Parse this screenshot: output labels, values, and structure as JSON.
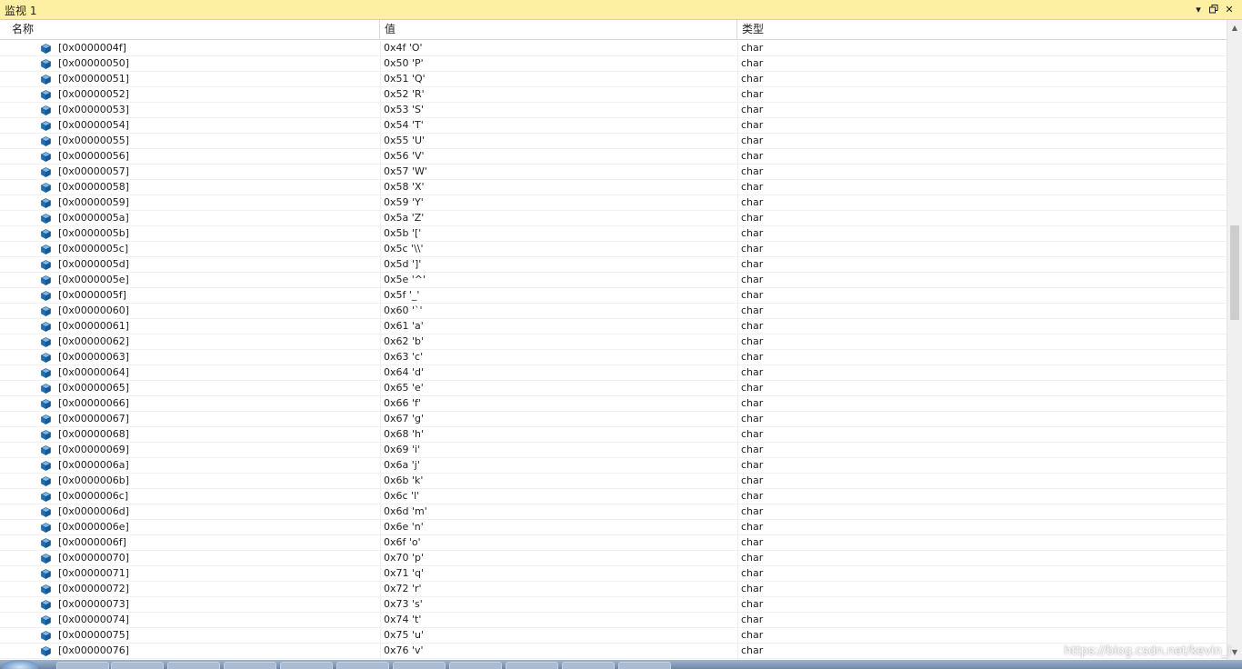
{
  "window": {
    "title": "监视 1"
  },
  "title_buttons": {
    "dropdown": "▾",
    "restore": "🗗",
    "close": "✕"
  },
  "columns": {
    "name": "名称",
    "value": "值",
    "type": "类型"
  },
  "rows": [
    {
      "name": "[0x0000004f]",
      "value": "0x4f 'O'",
      "type": "char"
    },
    {
      "name": "[0x00000050]",
      "value": "0x50 'P'",
      "type": "char"
    },
    {
      "name": "[0x00000051]",
      "value": "0x51 'Q'",
      "type": "char"
    },
    {
      "name": "[0x00000052]",
      "value": "0x52 'R'",
      "type": "char"
    },
    {
      "name": "[0x00000053]",
      "value": "0x53 'S'",
      "type": "char"
    },
    {
      "name": "[0x00000054]",
      "value": "0x54 'T'",
      "type": "char"
    },
    {
      "name": "[0x00000055]",
      "value": "0x55 'U'",
      "type": "char"
    },
    {
      "name": "[0x00000056]",
      "value": "0x56 'V'",
      "type": "char"
    },
    {
      "name": "[0x00000057]",
      "value": "0x57 'W'",
      "type": "char"
    },
    {
      "name": "[0x00000058]",
      "value": "0x58 'X'",
      "type": "char"
    },
    {
      "name": "[0x00000059]",
      "value": "0x59 'Y'",
      "type": "char"
    },
    {
      "name": "[0x0000005a]",
      "value": "0x5a 'Z'",
      "type": "char"
    },
    {
      "name": "[0x0000005b]",
      "value": "0x5b '['",
      "type": "char"
    },
    {
      "name": "[0x0000005c]",
      "value": "0x5c '\\\\'",
      "type": "char"
    },
    {
      "name": "[0x0000005d]",
      "value": "0x5d ']'",
      "type": "char"
    },
    {
      "name": "[0x0000005e]",
      "value": "0x5e '^'",
      "type": "char"
    },
    {
      "name": "[0x0000005f]",
      "value": "0x5f '_'",
      "type": "char"
    },
    {
      "name": "[0x00000060]",
      "value": "0x60 '`'",
      "type": "char"
    },
    {
      "name": "[0x00000061]",
      "value": "0x61 'a'",
      "type": "char"
    },
    {
      "name": "[0x00000062]",
      "value": "0x62 'b'",
      "type": "char"
    },
    {
      "name": "[0x00000063]",
      "value": "0x63 'c'",
      "type": "char"
    },
    {
      "name": "[0x00000064]",
      "value": "0x64 'd'",
      "type": "char"
    },
    {
      "name": "[0x00000065]",
      "value": "0x65 'e'",
      "type": "char"
    },
    {
      "name": "[0x00000066]",
      "value": "0x66 'f'",
      "type": "char"
    },
    {
      "name": "[0x00000067]",
      "value": "0x67 'g'",
      "type": "char"
    },
    {
      "name": "[0x00000068]",
      "value": "0x68 'h'",
      "type": "char"
    },
    {
      "name": "[0x00000069]",
      "value": "0x69 'i'",
      "type": "char"
    },
    {
      "name": "[0x0000006a]",
      "value": "0x6a 'j'",
      "type": "char"
    },
    {
      "name": "[0x0000006b]",
      "value": "0x6b 'k'",
      "type": "char"
    },
    {
      "name": "[0x0000006c]",
      "value": "0x6c 'l'",
      "type": "char"
    },
    {
      "name": "[0x0000006d]",
      "value": "0x6d 'm'",
      "type": "char"
    },
    {
      "name": "[0x0000006e]",
      "value": "0x6e 'n'",
      "type": "char"
    },
    {
      "name": "[0x0000006f]",
      "value": "0x6f 'o'",
      "type": "char"
    },
    {
      "name": "[0x00000070]",
      "value": "0x70 'p'",
      "type": "char"
    },
    {
      "name": "[0x00000071]",
      "value": "0x71 'q'",
      "type": "char"
    },
    {
      "name": "[0x00000072]",
      "value": "0x72 'r'",
      "type": "char"
    },
    {
      "name": "[0x00000073]",
      "value": "0x73 's'",
      "type": "char"
    },
    {
      "name": "[0x00000074]",
      "value": "0x74 't'",
      "type": "char"
    },
    {
      "name": "[0x00000075]",
      "value": "0x75 'u'",
      "type": "char"
    },
    {
      "name": "[0x00000076]",
      "value": "0x76 'v'",
      "type": "char"
    }
  ],
  "watermark": "https://blog.csdn.net/kevin_i",
  "colors": {
    "title_bar": "#fdf0a2",
    "row_icon": "#1f6fb5",
    "grid_line": "#f0f0f0"
  },
  "icons": {
    "row": "variable-cube-icon"
  }
}
